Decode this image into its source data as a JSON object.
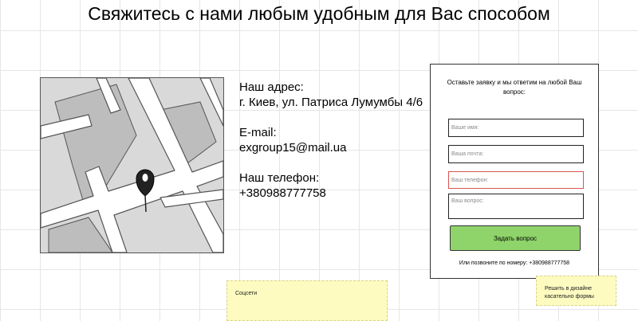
{
  "page": {
    "title": "Свяжитесь с нами любым удобным для Вас способом"
  },
  "contact": {
    "address_label": "Наш адрес:",
    "address_value": "г. Киев, ул. Патриса Лумумбы 4/6",
    "email_label": "E-mail:",
    "email_value": "exgroup15@mail.ua",
    "phone_label": "Наш телефон:",
    "phone_value": "+380988777758"
  },
  "form": {
    "heading": "Оставьте заявку и мы ответим на любой Ваш вопрос:",
    "name_placeholder": "Ваше имя:",
    "email_placeholder": "Ваша почта:",
    "phone_placeholder": "Ваш телефон:",
    "question_placeholder": "Ваш вопрос:",
    "submit_label": "Задать вопрос",
    "call_text": "Или позвоните по номеру: +380988777758",
    "error_color": "#d9534f",
    "submit_color": "#8fd46a"
  },
  "notes": {
    "socials": "Соцсети",
    "design_note": "Решить в дизайне касательно формы"
  },
  "icons": {
    "map_pin": "map-pin-icon"
  }
}
